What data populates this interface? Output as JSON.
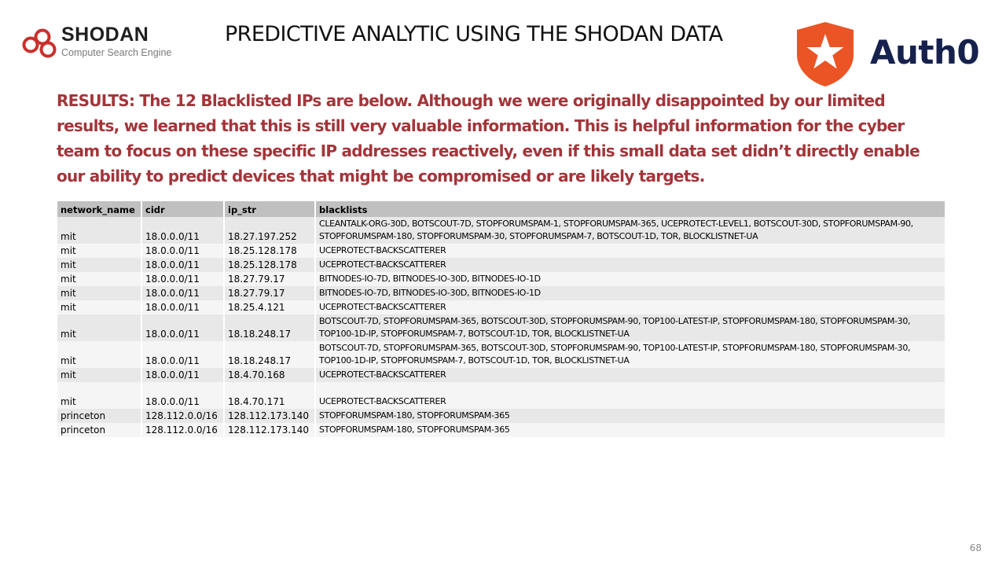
{
  "header": {
    "shodan_name": "SHODAN",
    "shodan_tagline": "Computer Search Engine",
    "title": "PREDICTIVE ANALYTIC USING THE SHODAN DATA",
    "auth0_name": "Auth0"
  },
  "results_text": "RESULTS: The 12 Blacklisted IPs are below. Although we were originally disappointed by our limited results, we learned that this is still very valuable information. This is helpful information for the cyber team to focus on these specific IP addresses reactively, even if this small data set didn’t directly enable our ability to predict devices that might be compromised or are likely targets.",
  "table": {
    "headers": [
      "network_name",
      "cidr",
      "ip_str",
      "blacklists"
    ],
    "rows": [
      [
        "mit",
        "18.0.0.0/11",
        "18.27.197.252",
        "CLEANTALK-ORG-30D, BOTSCOUT-7D, STOPFORUMSPAM-1, STOPFORUMSPAM-365, UCEPROTECT-LEVEL1, BOTSCOUT-30D, STOPFORUMSPAM-90, STOPFORUMSPAM-180, STOPFORUMSPAM-30, STOPFORUMSPAM-7, BOTSCOUT-1D, TOR, BLOCKLISTNET-UA"
      ],
      [
        "mit",
        "18.0.0.0/11",
        "18.25.128.178",
        "UCEPROTECT-BACKSCATTERER"
      ],
      [
        "mit",
        "18.0.0.0/11",
        "18.25.128.178",
        "UCEPROTECT-BACKSCATTERER"
      ],
      [
        "mit",
        "18.0.0.0/11",
        "18.27.79.17",
        "BITNODES-IO-7D, BITNODES-IO-30D, BITNODES-IO-1D"
      ],
      [
        "mit",
        "18.0.0.0/11",
        "18.27.79.17",
        "BITNODES-IO-7D, BITNODES-IO-30D, BITNODES-IO-1D"
      ],
      [
        "mit",
        "18.0.0.0/11",
        "18.25.4.121",
        "UCEPROTECT-BACKSCATTERER"
      ],
      [
        "mit",
        "18.0.0.0/11",
        "18.18.248.17",
        "BOTSCOUT-7D, STOPFORUMSPAM-365, BOTSCOUT-30D, STOPFORUMSPAM-90, TOP100-LATEST-IP, STOPFORUMSPAM-180, STOPFORUMSPAM-30, TOP100-1D-IP, STOPFORUMSPAM-7, BOTSCOUT-1D, TOR, BLOCKLISTNET-UA"
      ],
      [
        "mit",
        "18.0.0.0/11",
        "18.18.248.17",
        "BOTSCOUT-7D, STOPFORUMSPAM-365, BOTSCOUT-30D, STOPFORUMSPAM-90, TOP100-LATEST-IP, STOPFORUMSPAM-180, STOPFORUMSPAM-30, TOP100-1D-IP, STOPFORUMSPAM-7, BOTSCOUT-1D, TOR, BLOCKLISTNET-UA"
      ],
      [
        "mit",
        "18.0.0.0/11",
        "18.4.70.168",
        "UCEPROTECT-BACKSCATTERER"
      ],
      [
        "mit",
        "18.0.0.0/11",
        "18.4.70.171",
        "UCEPROTECT-BACKSCATTERER"
      ],
      [
        "princeton",
        "128.112.0.0/16",
        "128.112.173.140",
        "STOPFORUMSPAM-180, STOPFORUMSPAM-365"
      ],
      [
        "princeton",
        "128.112.0.0/16",
        "128.112.173.140",
        "STOPFORUMSPAM-180, STOPFORUMSPAM-365"
      ]
    ]
  },
  "page_number": "68",
  "colors": {
    "results_text": "#a3353a",
    "auth0_orange": "#eb5424",
    "auth0_navy": "#16214d",
    "shodan_red": "#c9302c",
    "header_row": "#c0c0c0"
  }
}
